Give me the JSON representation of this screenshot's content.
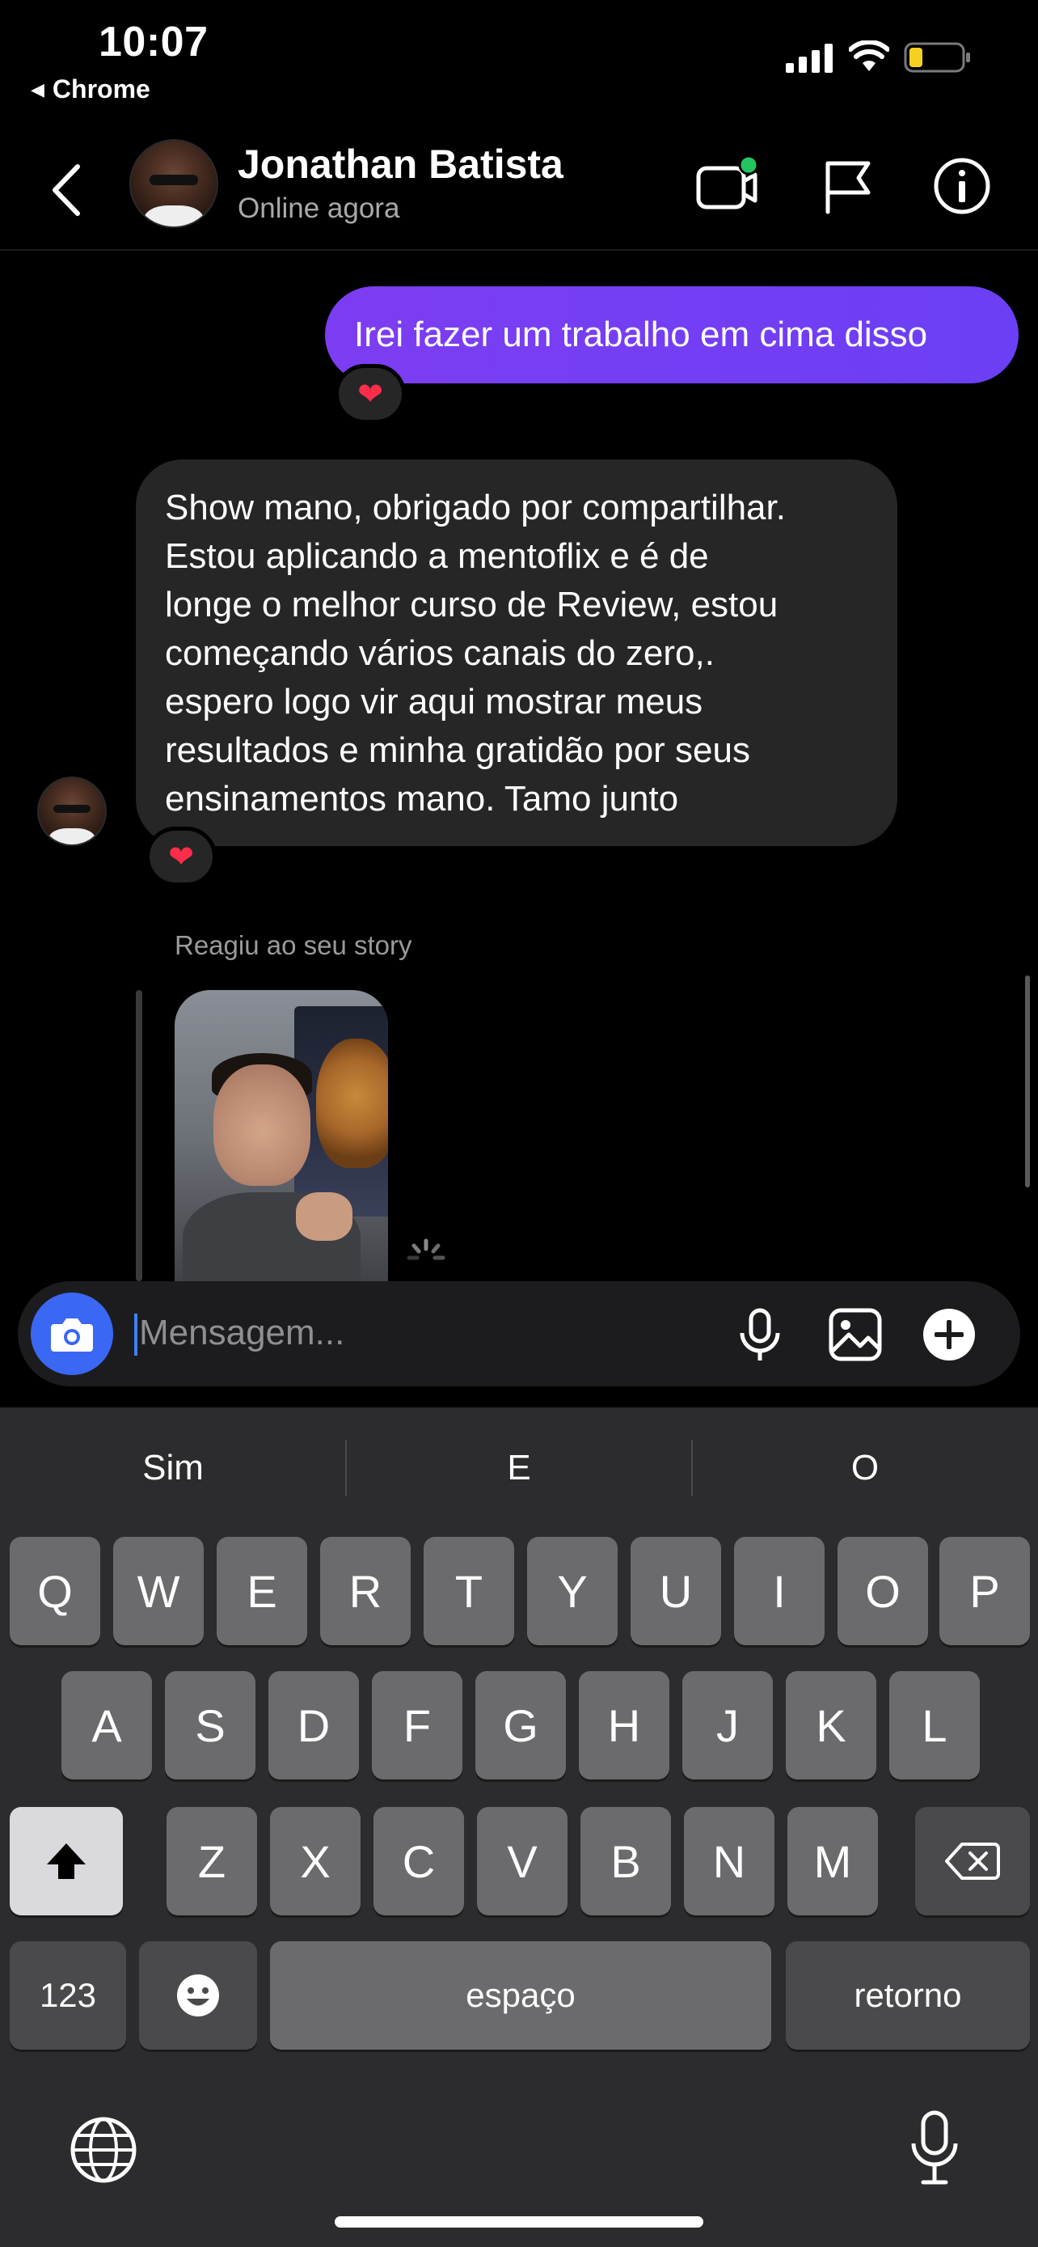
{
  "status_bar": {
    "time": "10:07",
    "back_app": "Chrome"
  },
  "header": {
    "contact_name": "Jonathan Batista",
    "contact_status": "Online agora"
  },
  "messages": {
    "outgoing_text": "Irei fazer um trabalho em cima disso",
    "outgoing_reaction": "❤",
    "incoming_lines": [
      "Show mano, obrigado por compartilhar.",
      "Estou aplicando a mentoflix e é de",
      "longe o melhor curso de Review, estou",
      "começando vários canais do zero,.",
      "espero logo vir aqui mostrar meus",
      "resultados e minha gratidão por seus",
      "ensinamentos mano. Tamo junto"
    ],
    "incoming_reaction": "❤",
    "story_label": "Reagiu ao seu story"
  },
  "composer": {
    "placeholder": "Mensagem..."
  },
  "keyboard": {
    "suggestions": [
      "Sim",
      "E",
      "O"
    ],
    "row1": [
      "Q",
      "W",
      "E",
      "R",
      "T",
      "Y",
      "U",
      "I",
      "O",
      "P"
    ],
    "row2": [
      "A",
      "S",
      "D",
      "F",
      "G",
      "H",
      "J",
      "K",
      "L"
    ],
    "row3": [
      "Z",
      "X",
      "C",
      "V",
      "B",
      "N",
      "M"
    ],
    "numbers_label": "123",
    "space_label": "espaço",
    "return_label": "retorno"
  },
  "colors": {
    "accent_purple": "#7d3df2",
    "camera_blue": "#3b67f5",
    "online_green": "#22c55e"
  }
}
